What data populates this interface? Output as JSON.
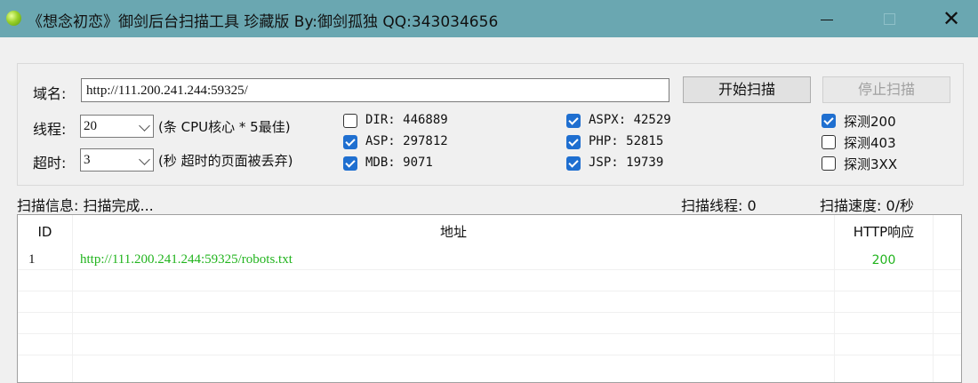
{
  "window": {
    "title": "《想念初恋》御剑后台扫描工具 珍藏版 By:御剑孤独 QQ:343034656"
  },
  "form": {
    "domain_label": "域名:",
    "domain_value": "http://111.200.241.244:59325/",
    "start_label": "开始扫描",
    "stop_label": "停止扫描",
    "threads_label": "线程:",
    "threads_value": "20",
    "threads_hint": "(条 CPU核心 * 5最佳)",
    "timeout_label": "超时:",
    "timeout_value": "3",
    "timeout_hint": "(秒 超时的页面被丢弃)"
  },
  "dictionaries": [
    {
      "label": "DIR: 446889",
      "checked": false
    },
    {
      "label": "ASP: 297812",
      "checked": true
    },
    {
      "label": "MDB: 9071",
      "checked": true
    },
    {
      "label": "ASPX: 42529",
      "checked": true
    },
    {
      "label": "PHP: 52815",
      "checked": true
    },
    {
      "label": "JSP: 19739",
      "checked": true
    }
  ],
  "detect": [
    {
      "label": "探测200",
      "checked": true
    },
    {
      "label": "探测403",
      "checked": false
    },
    {
      "label": "探测3XX",
      "checked": false
    }
  ],
  "status": {
    "info": "扫描信息: 扫描完成...",
    "threads": "扫描线程: 0",
    "speed": "扫描速度: 0/秒"
  },
  "table": {
    "headers": [
      "ID",
      "地址",
      "HTTP响应"
    ],
    "rows": [
      {
        "id": "1",
        "url": "http://111.200.241.244:59325/robots.txt",
        "code": "200"
      }
    ]
  },
  "colors": {
    "titlebar": "#6aa7b1",
    "result_text": "#22b41e",
    "checkbox": "#1f6fd0"
  }
}
